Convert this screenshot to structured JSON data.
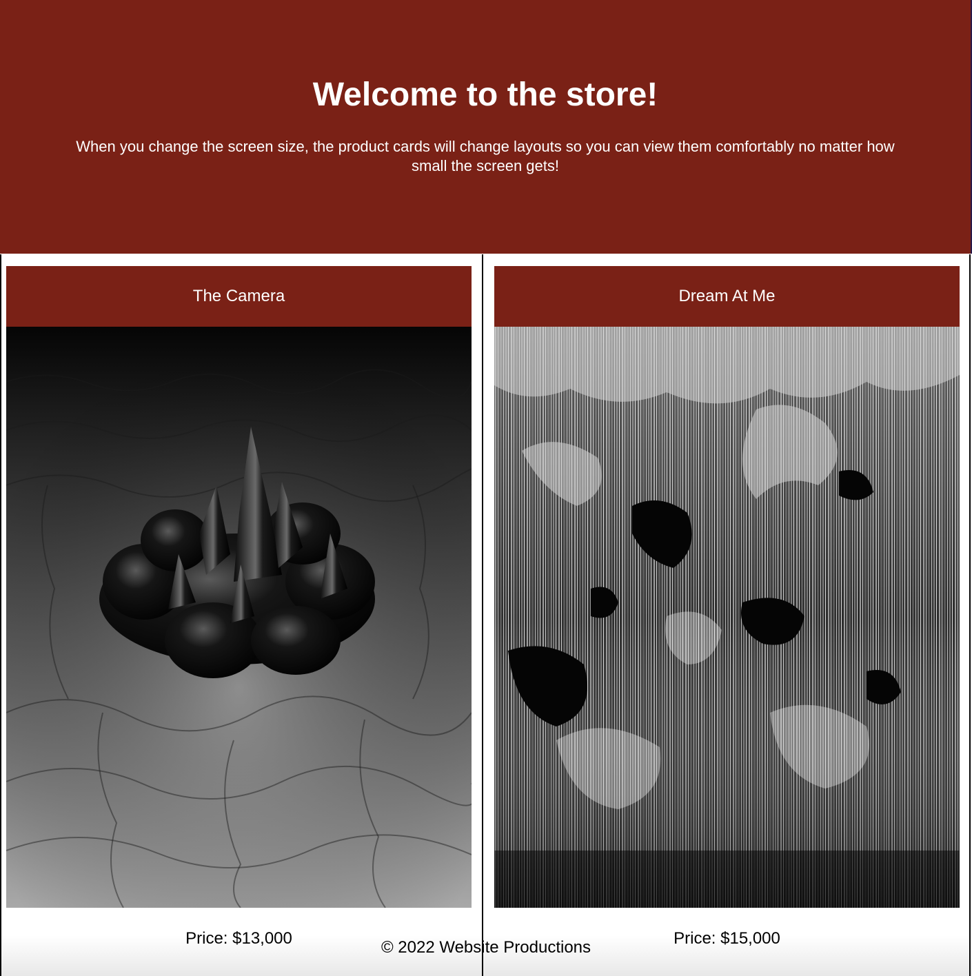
{
  "hero": {
    "title": "Welcome to the store!",
    "subtitle": "When you change the screen size, the product cards will change layouts so you can view them comfortably no matter how small the screen gets!"
  },
  "products": [
    {
      "name": "The Camera",
      "price": "Price: $13,000"
    },
    {
      "name": "Dream At Me",
      "price": "Price: $15,000"
    }
  ],
  "footer": {
    "text": "© 2022 Website Productions"
  },
  "colors": {
    "accent": "#7a2116",
    "text_on_accent": "#ffffff"
  }
}
